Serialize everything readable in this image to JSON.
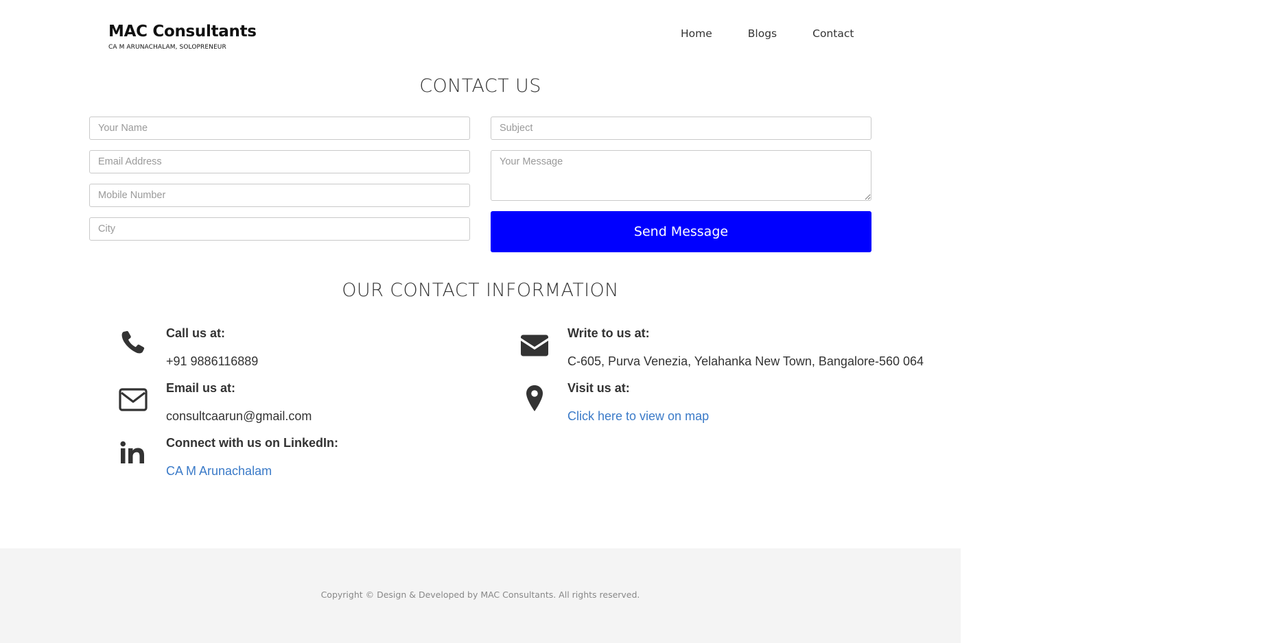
{
  "brand": {
    "name": "MAC Consultants",
    "tagline": "CA M ARUNACHALAM, SOLOPRENEUR"
  },
  "nav": {
    "items": [
      "Home",
      "Blogs",
      "Contact"
    ]
  },
  "contact": {
    "title": "CONTACT US",
    "fields": {
      "name": "Your Name",
      "subject": "Subject",
      "email": "Email Address",
      "message": "Your Message",
      "mobile": "Mobile Number",
      "city": "City"
    },
    "send_label": "Send Message",
    "button_color": "#0000ff"
  },
  "info": {
    "title": "OUR CONTACT INFORMATION",
    "call": {
      "label": "Call us at:",
      "value": "+91 9886116889",
      "icon": "phone-icon"
    },
    "email": {
      "label": "Email us at:",
      "value": "consultcaarun@gmail.com",
      "icon": "envelope-outline-icon"
    },
    "linkedin": {
      "label": "Connect with us on LinkedIn:",
      "value": "CA M Arunachalam",
      "icon": "linkedin-icon"
    },
    "write": {
      "label": "Write to us at:",
      "value": "C-605, Purva Venezia, Yelahanka New Town, Bangalore-560 064",
      "icon": "envelope-solid-icon"
    },
    "visit": {
      "label": "Visit us at:",
      "value": "Click here to view on map",
      "icon": "map-pin-icon"
    },
    "link_color": "#3a7ac8"
  },
  "footer": {
    "copyright": "Copyright © Design & Developed by MAC Consultants. All rights reserved."
  }
}
